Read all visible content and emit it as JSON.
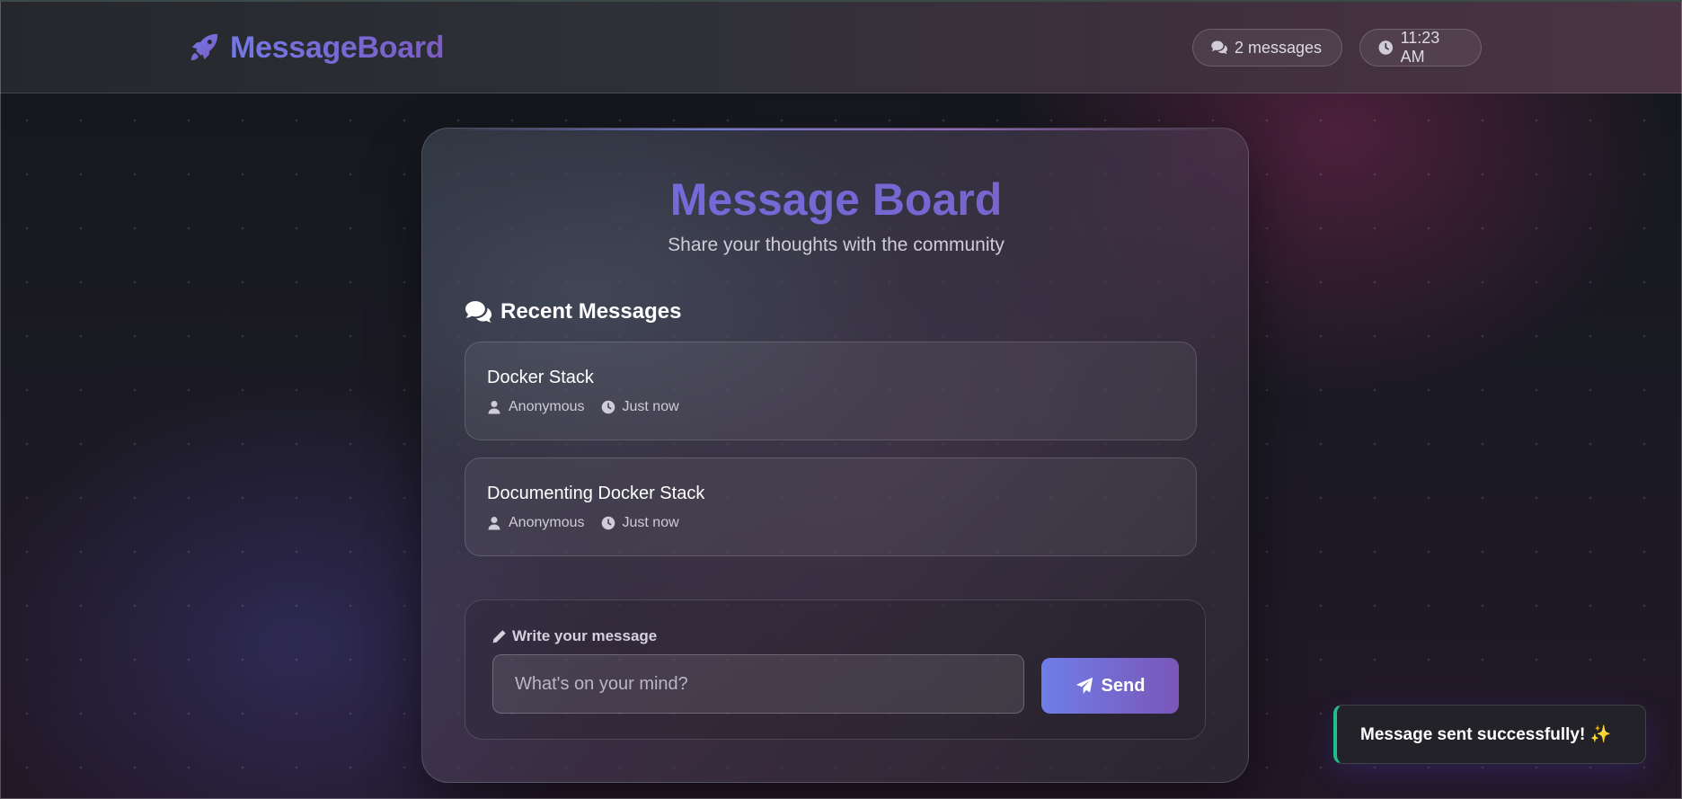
{
  "header": {
    "brand_icon": "rocket-icon",
    "brand_name": "MessageBoard",
    "message_count_label": "2 messages",
    "message_count_icon": "comments-icon",
    "time_label": "11:23 AM",
    "time_icon": "clock-icon"
  },
  "card": {
    "title": "Message Board",
    "subtitle": "Share your thoughts with the community",
    "section_title": "Recent Messages",
    "section_icon": "comments-icon"
  },
  "messages": [
    {
      "title": "Docker Stack",
      "author": "Anonymous",
      "time": "Just now"
    },
    {
      "title": "Documenting Docker Stack",
      "author": "Anonymous",
      "time": "Just now"
    }
  ],
  "composer": {
    "label": "Write your message",
    "label_icon": "pencil-icon",
    "placeholder": "What's on your mind?",
    "value": "",
    "send_label": "Send",
    "send_icon": "paper-plane-icon"
  },
  "toast": {
    "text": "Message sent successfully! ✨",
    "accent_color": "#20c08a"
  },
  "colors": {
    "brand_gradient_start": "#7479e6",
    "brand_gradient_end": "#7b5cc4",
    "send_gradient_start": "#6f7ee8",
    "send_gradient_end": "#7a56b8"
  }
}
